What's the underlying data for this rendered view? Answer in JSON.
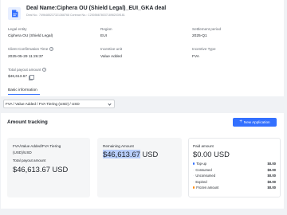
{
  "deal": {
    "title": "Deal Name:Ciphera OU (Shield Legal)_EUI_GKA deal",
    "subtitle": "Deal No.: 7496485237321368768  Contract No.: C2505667803718982039181",
    "fields": [
      {
        "label": "Legal entity",
        "value": "Ciphera OU (Shield Legal)"
      },
      {
        "label": "Region",
        "value": "EUI"
      },
      {
        "label": "Settlement period",
        "value": "2025-Q1"
      },
      {
        "label": "Client Confirmation Time",
        "value": "2025-05-29 11:26:37"
      },
      {
        "label": "Incentive unit",
        "value": "Value Added"
      },
      {
        "label": "Incentive Type",
        "value": "FVA"
      },
      {
        "label": "Total payout amount",
        "value": "$46,613.67"
      }
    ]
  },
  "tabs": {
    "basic": "Basic information"
  },
  "filter": {
    "selected": "FVA / Value Added / FVA Tiering (USD) / USD"
  },
  "amount_tracking": {
    "title": "Amount tracking",
    "new_button": "New Application",
    "left_box": {
      "category": "FVA/Value Added/FVA Tiering (USD)/USD",
      "label": "Total payout amount",
      "amount": "$46,613.67 USD"
    },
    "mid_box": {
      "label": "Remaining Amount",
      "amount_hl": "$46,613.67",
      "amount_rest": " USD"
    },
    "right_box": {
      "label": "Paid amount",
      "amount": "$0.00 USD",
      "rows": [
        {
          "label": "Top-up",
          "value": "$0.00"
        },
        {
          "label": "Consumed",
          "value": "$0.00"
        },
        {
          "label": "Unconsumed",
          "value": "$0.00"
        },
        {
          "label": "Expired",
          "value": "$0.00"
        },
        {
          "label": "Frozen amount",
          "value": "$0.00"
        }
      ]
    }
  },
  "colors": {
    "accent": "#3370ff",
    "frozen_dot": "#ff8800",
    "highlight": "#b8cefb"
  },
  "icons": [
    "document-icon",
    "info-icon",
    "copy-icon",
    "chevron-down-icon",
    "plus-icon"
  ]
}
